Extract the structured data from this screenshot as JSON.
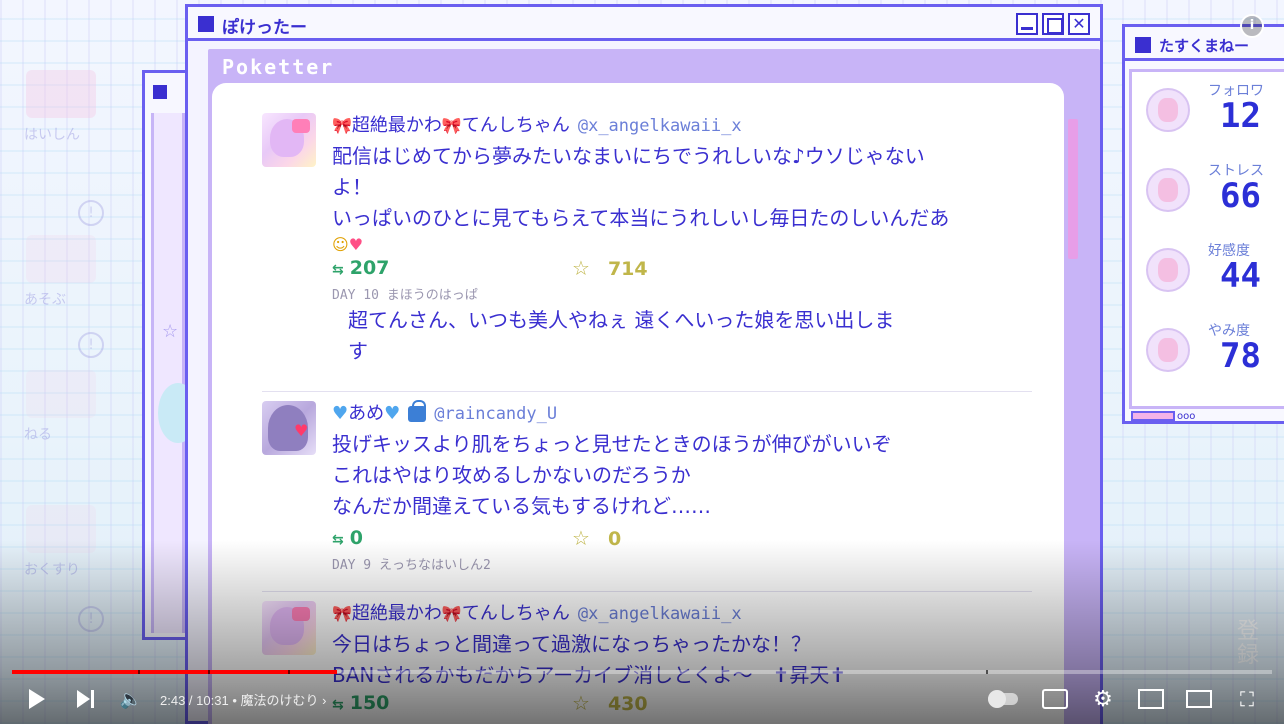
{
  "player": {
    "info_icon": "info-icon",
    "current_time": "2:43",
    "duration": "10:31",
    "time_separator": " / ",
    "chapter_separator": " • ",
    "chapter": "魔法のけむり",
    "chapter_chevron": "›",
    "progress": 0.258,
    "accent": "#ff0000",
    "watermark": "登録"
  },
  "left_menu": {
    "items": [
      {
        "label": "はいしん"
      },
      {
        "label": "あそぶ"
      },
      {
        "label": "ねる"
      },
      {
        "label": "おくすり"
      }
    ],
    "alert_glyph": "!"
  },
  "main_window": {
    "title": "ぽけったー",
    "brand": "Poketter",
    "close_glyph": "✕"
  },
  "posts": [
    {
      "ribbon": "🎀",
      "user": "超絶最かわ",
      "user_suffix": "てんしちゃん",
      "handle": "@x_angelkawaii_x",
      "lines": [
        "配信はじめてから夢みたいなまいにちでうれしいな♪ウソじゃない",
        "よ！",
        "いっぱいのひとに見てもらえて本当にうれしいし毎日たのしいんだあ"
      ],
      "emoji": "☺",
      "emoji_heart": "♥",
      "retweet_icon": "⇆",
      "retweets": "207",
      "star_icon": "☆",
      "favs": "714",
      "day": "DAY 10 まほうのはっぱ",
      "reply_lines": [
        "超てんさん、いつも美人やねぇ 遠くへいった娘を思い出しま",
        "す"
      ]
    },
    {
      "heart": "♥",
      "user": "あめ",
      "handle": "@raincandy_U",
      "lines": [
        "投げキッスより肌をちょっと見せたときのほうが伸びがいいぞ",
        "これはやはり攻めるしかないのだろうか",
        "なんだか間違えている気もするけれど……"
      ],
      "retweet_icon": "⇆",
      "retweets": "0",
      "star_icon": "☆",
      "favs": "0",
      "day": "DAY 9 えっちなはいしん2"
    },
    {
      "ribbon": "🎀",
      "user": "超絶最かわ",
      "user_suffix": "てんしちゃん",
      "handle": "@x_angelkawaii_x",
      "lines": [
        "今日はちょっと間違って過激になっちゃったかな！？",
        "BANされるかもだからアーカイブ消しとくよ～　✝昇天✝"
      ],
      "retweet_icon": "⇆",
      "retweets": "150",
      "star_icon": "☆",
      "favs": "430"
    }
  ],
  "status_window": {
    "title": "たすくまねー",
    "stats": [
      {
        "label": "フォロワ",
        "value": "12"
      },
      {
        "label": "ストレス",
        "value": "66"
      },
      {
        "label": "好感度",
        "value": "44"
      },
      {
        "label": "やみ度",
        "value": "78"
      }
    ],
    "footer": "ooo"
  },
  "colors": {
    "window_border": "#6a5ff0",
    "text": "#3a2fd0",
    "frame": "#c8b4f7",
    "retweet": "#2ea36a",
    "fav": "#c0b64a"
  }
}
